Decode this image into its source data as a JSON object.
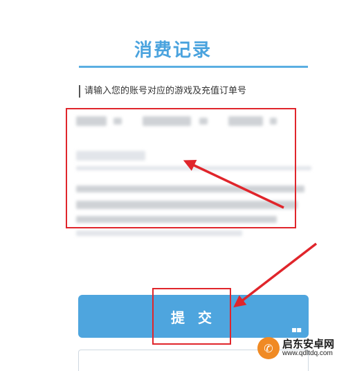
{
  "page": {
    "title": "消费记录",
    "instruction": "请输入您的账号对应的游戏及充值订单号",
    "submit_label": "提 交"
  },
  "colors": {
    "title": "#4aa3de",
    "title_rule": "#5aaee2",
    "submit_bg": "#4ea5de",
    "highlight": "#e0252b",
    "arrow": "#e0252b"
  },
  "form": {
    "fields_redacted": true
  },
  "icons": {
    "watermark_logo": "phone-logo-icon",
    "arrow_1": "red-arrow-to-form",
    "arrow_2": "red-arrow-to-submit"
  },
  "watermark": {
    "name": "启东安卓网",
    "url": "www.qdltdq.com"
  }
}
